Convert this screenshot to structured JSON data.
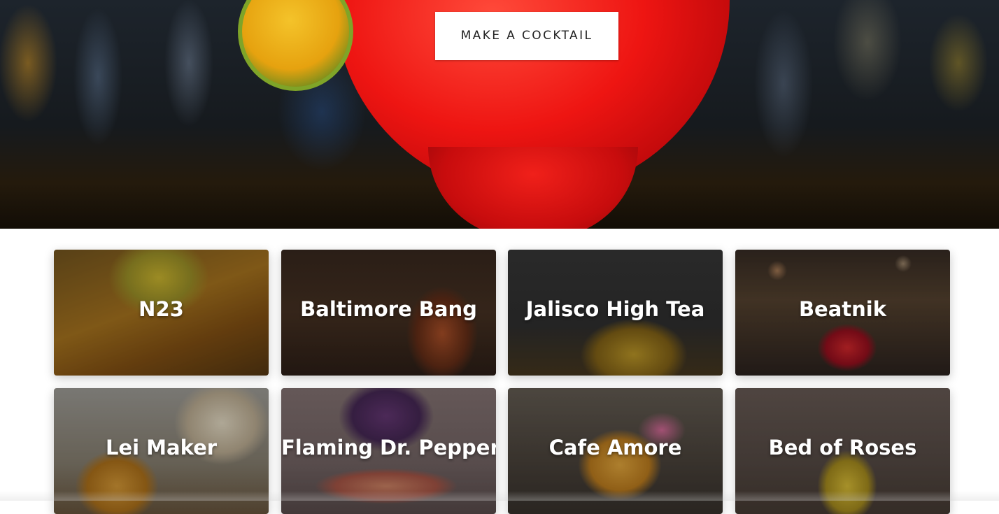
{
  "hero": {
    "cta_label": "MAKE A COCKTAIL",
    "image": "red-cocktail-with-lime-photo"
  },
  "cocktails": [
    {
      "name": "N23",
      "image": "yellow-margarita-photo"
    },
    {
      "name": "Baltimore Bang",
      "image": "copper-mug-bar-photo"
    },
    {
      "name": "Jalisco High Tea",
      "image": "pouring-cocktail-photo"
    },
    {
      "name": "Beatnik",
      "image": "red-margarita-bar-photo"
    },
    {
      "name": "Lei Maker",
      "image": "mason-jar-drink-flowers-photo"
    },
    {
      "name": "Flaming Dr. Pepper",
      "image": "cocktail-flight-photo"
    },
    {
      "name": "Cafe Amore",
      "image": "garnished-tropical-drink-photo"
    },
    {
      "name": "Bed of Roses",
      "image": "yellow-highball-photo"
    }
  ]
}
